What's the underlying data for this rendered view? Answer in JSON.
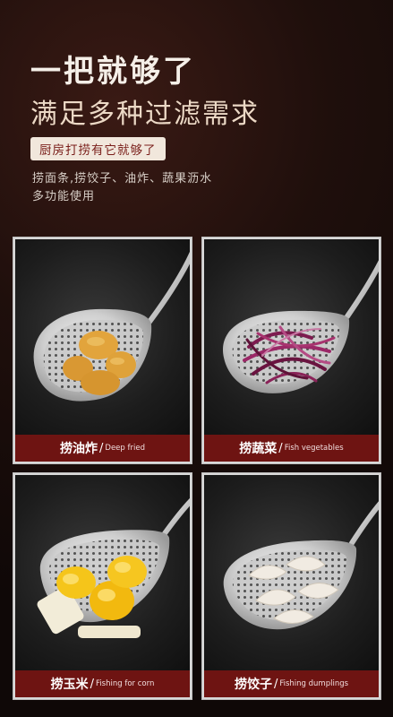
{
  "header": {
    "headline": "一把就够了",
    "subheadline": "满足多种过滤需求",
    "tag": "厨房打捞有它就够了",
    "desc_line1": "捞面条,捞饺子、油炸、蔬果沥水",
    "desc_line2": "多功能使用"
  },
  "cards": [
    {
      "label_cn": "捞油炸",
      "separator": "/",
      "label_en": "Deep fried",
      "food_icon": "fried-chicken-icon"
    },
    {
      "label_cn": "捞蔬菜",
      "separator": "/",
      "label_en": "Fish vegetables",
      "food_icon": "shredded-cabbage-icon"
    },
    {
      "label_cn": "捞玉米",
      "separator": "/",
      "label_en": "Fishing for corn",
      "food_icon": "corn-icon"
    },
    {
      "label_cn": "捞饺子",
      "separator": "/",
      "label_en": "Fishing dumplings",
      "food_icon": "dumplings-icon"
    }
  ],
  "colors": {
    "caption_bg": "#6e1412",
    "tag_bg": "#f1e7dc",
    "tag_text": "#7a1e1a"
  }
}
